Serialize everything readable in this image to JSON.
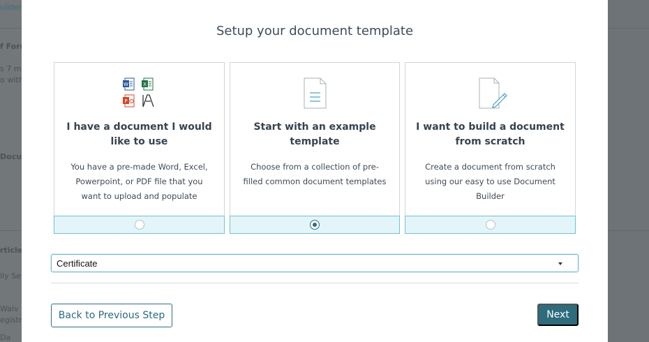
{
  "modal": {
    "title": "Setup your document template"
  },
  "options": [
    {
      "title": "I have a document I would like to use",
      "description": "You have a pre-made Word, Excel, Powerpoint, or PDF file that you want to upload and populate",
      "icon": "office-files-icon",
      "selected": false
    },
    {
      "title": "Start with an example template",
      "description": "Choose from a collection of pre-filled common document templates",
      "icon": "document-template-icon",
      "selected": true
    },
    {
      "title": "I want to build a document from scratch",
      "description": "Create a document from scratch using our easy to use Document Builder",
      "icon": "document-edit-icon",
      "selected": false
    }
  ],
  "template_select": {
    "value": "Certificate"
  },
  "footer": {
    "back_label": "Back to Previous Step",
    "next_label": "Next"
  },
  "backdrop": {
    "left_fragments": [
      "uilder",
      "f Form",
      "s 7 m",
      "o with",
      "Docu",
      "rticles",
      "lly Set",
      "Waiv",
      "egistr",
      "Da"
    ]
  },
  "colors": {
    "accent": "#2d6b7d",
    "radio_bar": "#e4f5f9",
    "radio_bar_border": "#6fc1d6"
  }
}
